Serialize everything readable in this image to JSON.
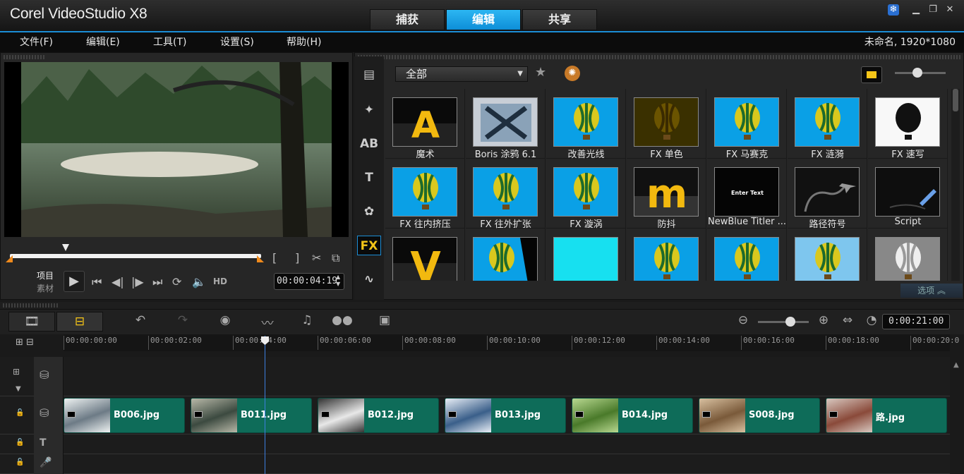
{
  "app": {
    "title": "Corel VideoStudio X8"
  },
  "modes": [
    {
      "label": "捕获",
      "active": false
    },
    {
      "label": "编辑",
      "active": true
    },
    {
      "label": "共享",
      "active": false
    }
  ],
  "menu": [
    "文件(F)",
    "编辑(E)",
    "工具(T)",
    "设置(S)",
    "帮助(H)"
  ],
  "project_info": "未命名, 1920*1080",
  "preview": {
    "mode_project": "项目",
    "mode_clip": "素材",
    "hd_label": "HD",
    "timecode": "00:00:04:19"
  },
  "library": {
    "category": "全部",
    "options_label": "选项",
    "filters": [
      {
        "label": "魔术",
        "icon": "letter-a-icon"
      },
      {
        "label": "Boris 涂鸦 6.1",
        "icon": "x-mark-icon"
      },
      {
        "label": "改善光线",
        "icon": "balloon-icon"
      },
      {
        "label": "FX 单色",
        "icon": "balloon-icon"
      },
      {
        "label": "FX 马赛克",
        "icon": "balloon-icon"
      },
      {
        "label": "FX 涟漪",
        "icon": "balloon-icon"
      },
      {
        "label": "FX 速写",
        "icon": "balloon-icon"
      },
      {
        "label": "FX 往内挤压",
        "icon": "balloon-icon"
      },
      {
        "label": "FX 往外扩张",
        "icon": "balloon-icon"
      },
      {
        "label": "FX 漩涡",
        "icon": "balloon-icon"
      },
      {
        "label": "防抖",
        "icon": "letter-m-icon"
      },
      {
        "label": "NewBlue Titler ...",
        "icon": "enter-text-icon"
      },
      {
        "label": "路径符号",
        "icon": "airplane-path-icon"
      },
      {
        "label": "Script",
        "icon": "pen-icon"
      },
      {
        "label": "",
        "icon": "letter-v-icon"
      },
      {
        "label": "",
        "icon": "balloon-icon"
      },
      {
        "label": "",
        "icon": "cyan-icon"
      },
      {
        "label": "",
        "icon": "balloon-icon"
      },
      {
        "label": "",
        "icon": "balloon-icon"
      },
      {
        "label": "",
        "icon": "balloon-icon"
      },
      {
        "label": "",
        "icon": "balloon-icon"
      }
    ],
    "thumb_text": "Enter Text"
  },
  "timeline": {
    "total_time": "0:00:21:00",
    "ruler": [
      "00:00:00:00",
      "00:00:02:00",
      "00:00:04:00",
      "00:00:06:00",
      "00:00:08:00",
      "00:00:10:00",
      "00:00:12:00",
      "00:00:14:00",
      "00:00:16:00",
      "00:00:18:00",
      "00:00:20:0"
    ],
    "clips": [
      "B006.jpg",
      "B011.jpg",
      "B012.jpg",
      "B013.jpg",
      "B014.jpg",
      "S008.jpg",
      "路.jpg"
    ]
  },
  "colors": {
    "accent": "#1b8dd6",
    "clip": "#0e6c59",
    "fx_bg": "#0aa0e6"
  }
}
